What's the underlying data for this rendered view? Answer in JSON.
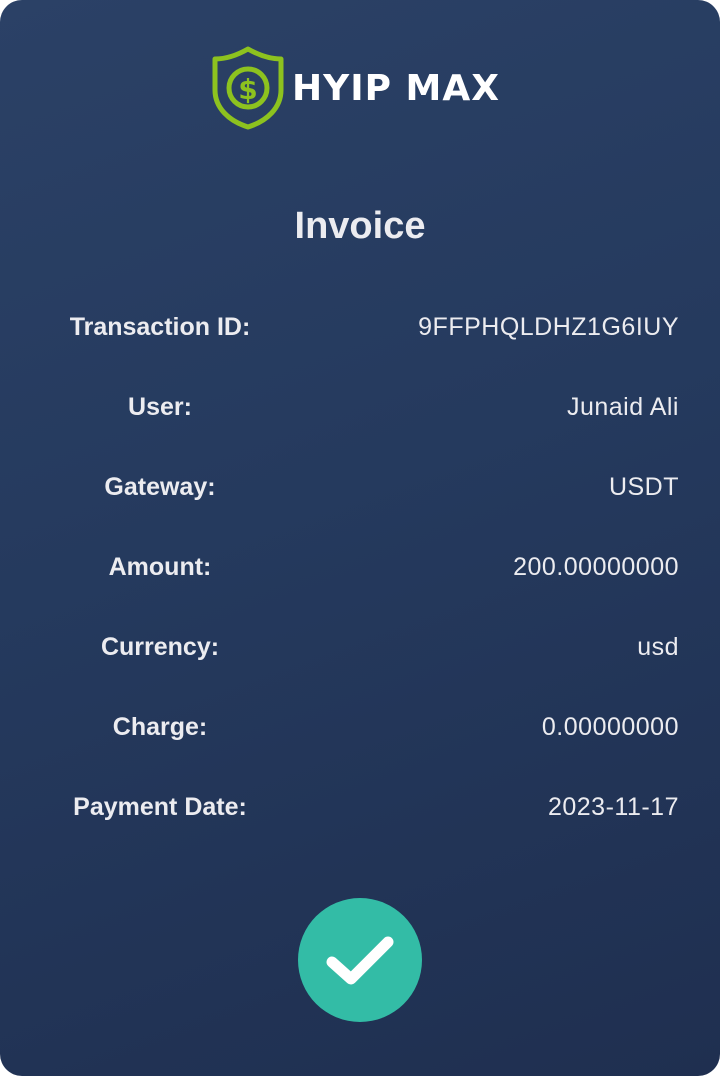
{
  "brand": {
    "name": "HYIP MAX",
    "icon": "shield-dollar-icon",
    "accent_color": "#8dc21f"
  },
  "invoice": {
    "title": "Invoice",
    "rows": [
      {
        "label": "Transaction ID:",
        "value": "9FFPHQLDHZ1G6IUY"
      },
      {
        "label": "User:",
        "value": "Junaid Ali"
      },
      {
        "label": "Gateway:",
        "value": "USDT"
      },
      {
        "label": "Amount:",
        "value": "200.00000000"
      },
      {
        "label": "Currency:",
        "value": "usd"
      },
      {
        "label": "Charge:",
        "value": "0.00000000"
      },
      {
        "label": "Payment Date:",
        "value": "2023-11-17"
      }
    ]
  },
  "status": {
    "icon": "check-icon",
    "color": "#33bca6"
  }
}
